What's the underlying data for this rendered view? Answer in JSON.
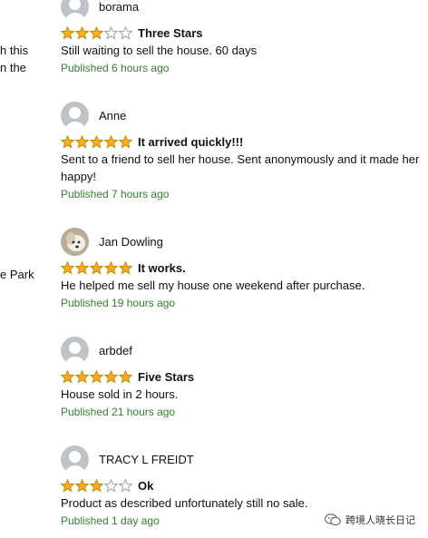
{
  "left_fragments": [
    "h this",
    "n the",
    "e Park"
  ],
  "reviews": [
    {
      "author": "borama",
      "avatar": "default-avatar",
      "stars": 3,
      "title": "Three Stars",
      "text": "Still waiting to sell the house. 60 days",
      "published": "Published 6 hours ago"
    },
    {
      "author": "Anne",
      "avatar": "default-avatar",
      "stars": 5,
      "title": "It arrived quickly!!!",
      "text": "Sent to a friend to sell her house. Sent anonymously and it made her happy!",
      "published": "Published 7 hours ago"
    },
    {
      "author": "Jan Dowling",
      "avatar": "dog-photo-avatar",
      "stars": 5,
      "title": "It works.",
      "text": "He helped me sell my house one weekend after purchase.",
      "published": "Published 19 hours ago"
    },
    {
      "author": "arbdef",
      "avatar": "default-avatar",
      "stars": 5,
      "title": "Five Stars",
      "text": "House sold in 2 hours.",
      "published": "Published 21 hours ago"
    },
    {
      "author": "TRACY L FREIDT",
      "avatar": "default-avatar",
      "stars": 3,
      "title": "Ok",
      "text": "Product as described unfortunately still no sale.",
      "published": "Published 1 day ago"
    }
  ],
  "max_stars": 5,
  "watermark": {
    "text": "跨境人晓长日记",
    "icon": "wechat-icon"
  },
  "colors": {
    "star_fill": "#f2b01e",
    "star_stroke": "#c88a04",
    "star_empty_stroke": "#a0a0a0",
    "published": "#34802c"
  }
}
